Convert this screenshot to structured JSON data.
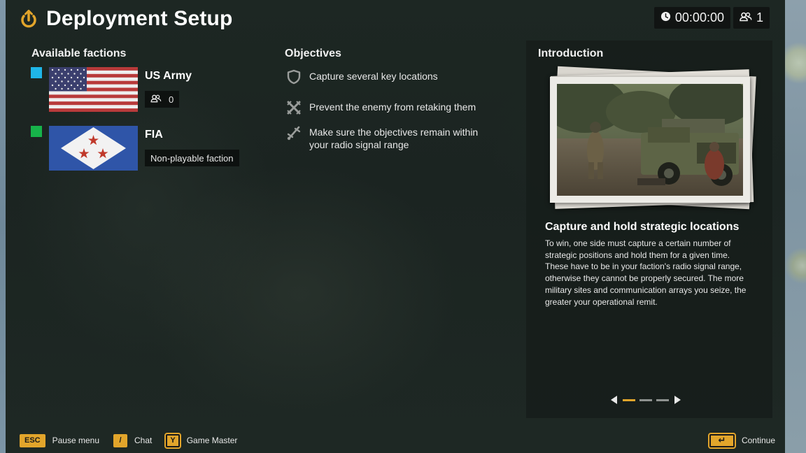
{
  "header": {
    "title": "Deployment Setup",
    "timer": "00:00:00",
    "players": "1"
  },
  "factions": {
    "title": "Available factions",
    "items": [
      {
        "name": "US Army",
        "color": "#1fb6e8",
        "tag_type": "players",
        "players": "0"
      },
      {
        "name": "FIA",
        "color": "#17b34a",
        "tag_type": "label",
        "tag": "Non-playable faction"
      }
    ]
  },
  "objectives": {
    "title": "Objectives",
    "items": [
      {
        "icon": "shield-icon",
        "text": "Capture several key locations"
      },
      {
        "icon": "crossed-swords-icon",
        "text": "Prevent the enemy from retaking them"
      },
      {
        "icon": "radio-signal-icon",
        "text": "Make sure the objectives remain within your radio signal range"
      }
    ]
  },
  "intro": {
    "title": "Introduction",
    "heading": "Capture and hold strategic locations",
    "body": "To win, one side must capture a certain number of strategic positions and hold them for a given time. These have to be in your faction's radio signal range, otherwise they cannot be properly secured. The more military sites and communication arrays you seize, the greater your operational remit.",
    "pages": 3,
    "active_page": 0
  },
  "footer": {
    "hints": [
      {
        "key": "ESC",
        "label": "Pause menu"
      },
      {
        "key": "/",
        "label": "Chat"
      },
      {
        "key": "Y",
        "label": "Game Master"
      }
    ],
    "continue_key": "↵",
    "continue_label": "Continue"
  },
  "colors": {
    "accent": "#e2a52b",
    "us_army": "#1fb6e8",
    "fia": "#17b34a"
  }
}
